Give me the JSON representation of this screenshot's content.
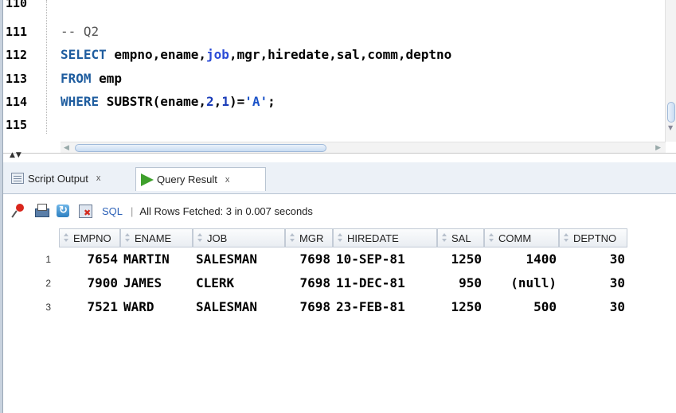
{
  "editor": {
    "lines": [
      {
        "num": "110",
        "text": ""
      },
      {
        "num": "111",
        "text": "-- Q2"
      },
      {
        "num": "112",
        "kw": "SELECT",
        "text_a": " empno,ename,",
        "ident": "job",
        "text_b": ",mgr,hiredate,sal,comm,deptno"
      },
      {
        "num": "113",
        "kw": "FROM",
        "text": " emp"
      },
      {
        "num": "114",
        "kw": "WHERE",
        "text_a": " SUBSTR(ename,",
        "n1": "2",
        "comma": ",",
        "n2": "1",
        "text_b": ")=",
        "str": "'A'",
        "end": ";"
      },
      {
        "num": "115",
        "text": ""
      }
    ]
  },
  "tabs": {
    "script_output": "Script Output",
    "query_result": "Query Result",
    "close": "x"
  },
  "toolbar": {
    "sql_label": "SQL",
    "separator": "|",
    "status": "All Rows Fetched: 3 in 0.007 seconds"
  },
  "grid": {
    "columns": [
      "EMPNO",
      "ENAME",
      "JOB",
      "MGR",
      "HIREDATE",
      "SAL",
      "COMM",
      "DEPTNO"
    ],
    "rows": [
      {
        "n": "1",
        "empno": "7654",
        "ename": "MARTIN",
        "job": "SALESMAN",
        "mgr": "7698",
        "hiredate": "10-SEP-81",
        "sal": "1250",
        "comm": "1400",
        "deptno": "30"
      },
      {
        "n": "2",
        "empno": "7900",
        "ename": "JAMES",
        "job": "CLERK",
        "mgr": "7698",
        "hiredate": "11-DEC-81",
        "sal": "950",
        "comm": "(null)",
        "deptno": "30"
      },
      {
        "n": "3",
        "empno": "7521",
        "ename": "WARD",
        "job": "SALESMAN",
        "mgr": "7698",
        "hiredate": "23-FEB-81",
        "sal": "1250",
        "comm": "500",
        "deptno": "30"
      }
    ]
  },
  "colors": {
    "keyword": "#1f5d9f",
    "play_icon": "#3fa02c",
    "sql_link": "#2f63b8"
  }
}
